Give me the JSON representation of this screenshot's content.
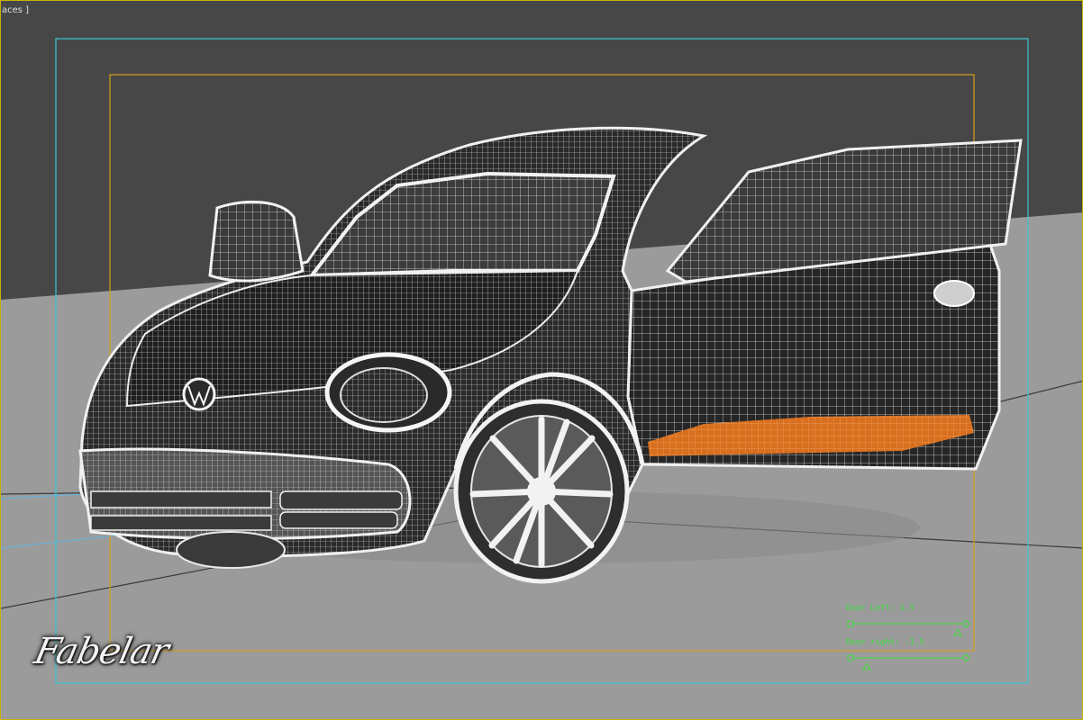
{
  "viewport": {
    "label": "aces ]",
    "colors": {
      "background": "#474747",
      "ground": "#9a9a9a",
      "safe_frame_outer": "#3ac9d6",
      "safe_frame_inner": "#d4a11e",
      "wire": "#e8e8e8",
      "body_dark": "#232323",
      "orange": "#e07a24",
      "hud_green": "#3fe23f"
    }
  },
  "hud": {
    "door_left_label": "Door Left: 1.5",
    "door_right_label": "Door right: -1.5",
    "door_left_value": 1.5,
    "door_right_value": -1.5
  },
  "branding": {
    "logo_text": "Fabelar"
  },
  "icons": {
    "viewport_menu": "bracket-menu-icon",
    "slider_handle": "triangle-icon",
    "slider_end": "diamond-icon",
    "slider_start": "square-plus-icon"
  }
}
